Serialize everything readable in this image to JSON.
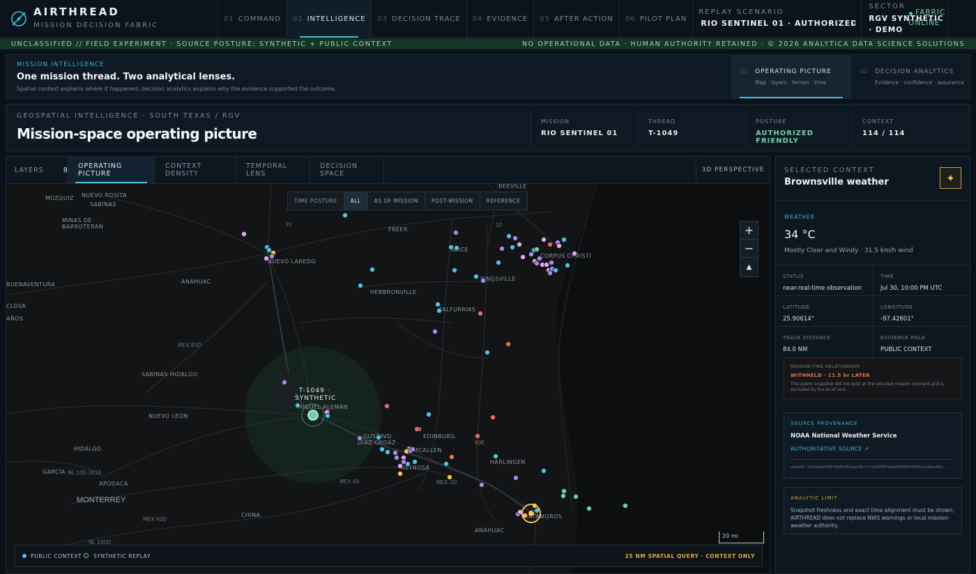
{
  "brand": {
    "name": "AIRTHREAD",
    "subtitle": "MISSION DECISION FABRIC",
    "icon": "compass-slash-icon"
  },
  "nav": [
    {
      "num": "01",
      "label": "COMMAND",
      "active": false
    },
    {
      "num": "02",
      "label": "INTELLIGENCE",
      "active": true
    },
    {
      "num": "03",
      "label": "DECISION TRACE",
      "active": false
    },
    {
      "num": "04",
      "label": "EVIDENCE",
      "active": false
    },
    {
      "num": "05",
      "label": "AFTER ACTION",
      "active": false
    },
    {
      "num": "06",
      "label": "PILOT PLAN",
      "active": false
    }
  ],
  "replay": {
    "label": "REPLAY SCENARIO",
    "value": "RIO SENTINEL 01 · AUTHORIZED FRIENDLY"
  },
  "sector": {
    "label": "SECTOR",
    "value": "RGV SYNTHETIC · DEMO"
  },
  "fabric_status": "FABRIC ONLINE",
  "classification": {
    "left": "UNCLASSIFIED // FIELD EXPERIMENT · SOURCE POSTURE: SYNTHETIC + PUBLIC CONTEXT",
    "right": "NO OPERATIONAL DATA · HUMAN AUTHORITY RETAINED · © 2026 ANALYTICA DATA SCIENCE SOLUTIONS"
  },
  "mission_intel": {
    "kicker": "MISSION INTELLIGENCE",
    "title": "One mission thread. Two analytical lenses.",
    "desc": "Spatial context explains where it happened; decision analytics explains why the evidence supported the outcome.",
    "lenses": [
      {
        "num": "01",
        "title": "OPERATING PICTURE",
        "sub": "Map · layers · terrain · time",
        "active": true
      },
      {
        "num": "02",
        "title": "DECISION ANALYTICS",
        "sub": "Evidence · confidence · assurance",
        "active": false
      }
    ]
  },
  "geo": {
    "kicker": "GEOSPATIAL INTELLIGENCE · SOUTH TEXAS / RGV",
    "title": "Mission-space operating picture",
    "stats": [
      {
        "k": "MISSION",
        "v": "RIO SENTINEL 01",
        "color": "#e5ecf1"
      },
      {
        "k": "THREAD",
        "v": "T-1049",
        "color": "#e5ecf1"
      },
      {
        "k": "POSTURE",
        "v": "AUTHORIZED FRIENDLY",
        "color": "#6ed3a3"
      },
      {
        "k": "CONTEXT",
        "v": "114 / 114",
        "color": "#e5ecf1"
      }
    ]
  },
  "map_tabs": {
    "layers_label": "LAYERS",
    "layers_count": "8",
    "tabs": [
      "OPERATING PICTURE",
      "CONTEXT DENSITY",
      "TEMPORAL LENS",
      "DECISION SPACE"
    ],
    "perspective": "3D PERSPECTIVE"
  },
  "time_posture": {
    "label": "TIME POSTURE",
    "options": [
      "ALL",
      "AS OF MISSION",
      "POST-MISSION",
      "REFERENCE"
    ],
    "active": "ALL"
  },
  "zoom": {
    "in": "+",
    "out": "−",
    "reset": "▲"
  },
  "map_labels": {
    "cities": [
      "NUEVO ROSITA",
      "SABINAS",
      "MÚZQUIZ",
      "MINAS DE",
      "BARROTERÁN",
      "NUEVO LAREDO",
      "ANÁHUAC",
      "BUENAVENTURA",
      "CLOVA",
      "AÑOS",
      "HEBBRONVILLE",
      "FALFURRIAS",
      "KINGSVILLE",
      "CORPUS CHRISTI",
      "FREER",
      "ALICE",
      "BEEVILLE",
      "SABINAS HIDALGO",
      "NUEVO LEÓN",
      "MIGUEL ALEMÁN",
      "GUSTAVO",
      "DÍAZ ORDAZ",
      "REYNOSA",
      "MCALLEN",
      "EDINBURG",
      "HARLINGEN",
      "MATAMOROS",
      "ANÁHUAC",
      "CHINA",
      "HIDALGO",
      "GARCÍA",
      "APODACA",
      "MONTERREY"
    ],
    "roads": [
      "35",
      "37",
      "MEX 85D",
      "69E",
      "MEX 40",
      "MEX 2D",
      "MEX 40D",
      "NL 100D",
      "NL 100-1610"
    ]
  },
  "thread_marker": {
    "id": "T-1049 ·",
    "tag": "SYNTHETIC"
  },
  "scale_label": "20 mi",
  "legend": {
    "public": "PUBLIC CONTEXT",
    "synthetic": "SYNTHETIC REPLAY",
    "query": "25 NM SPATIAL QUERY · CONTEXT ONLY"
  },
  "colors": {
    "public": "#4ec3e4",
    "synthetic": "#6ad4a4",
    "purple": "#a68be6",
    "red": "#e86b65",
    "pink": "#e3a6ef",
    "amber": "#f0c35a"
  },
  "context": {
    "kicker": "SELECTED CONTEXT",
    "title": "Brownsville weather",
    "star_icon": "sparkle-icon",
    "weather_kicker": "WEATHER",
    "temp": "34 °C",
    "cond": "Mostly Clear and Windy · 31.5 km/h wind",
    "cells": [
      {
        "k": "STATUS",
        "v": "near-real-time observation"
      },
      {
        "k": "TIME",
        "v": "Jul 30, 10:00 PM UTC"
      },
      {
        "k": "LATITUDE",
        "v": "25.90614°"
      },
      {
        "k": "LONGITUDE",
        "v": "-97.42601°"
      },
      {
        "k": "TRACK DISTANCE",
        "v": "84.0 NM"
      },
      {
        "k": "EVIDENCE ROLE",
        "v": "PUBLIC CONTEXT"
      }
    ],
    "withheld": {
      "k": "MISSION-TIME RELATIONSHIP",
      "v": "WITHHELD · 11.5 hr LATER",
      "desc": "This public snapshot did not exist at the selected mission moment and is excluded by the as-of lens."
    },
    "provenance": {
      "k": "SOURCE PROVENANCE",
      "v": "NOAA National Weather Service",
      "link": "AUTHORITATIVE SOURCE ↗",
      "hash": "sha256:7d2de81b309f484b3622ae78cfcfe349367e69db569014548ccb28ce041..."
    },
    "limit": {
      "k": "ANALYTIC LIMIT",
      "desc": "Snapshot freshness and exact time alignment must be shown; AIRTHREAD does not replace NWS warnings or local mission-weather authority."
    }
  }
}
